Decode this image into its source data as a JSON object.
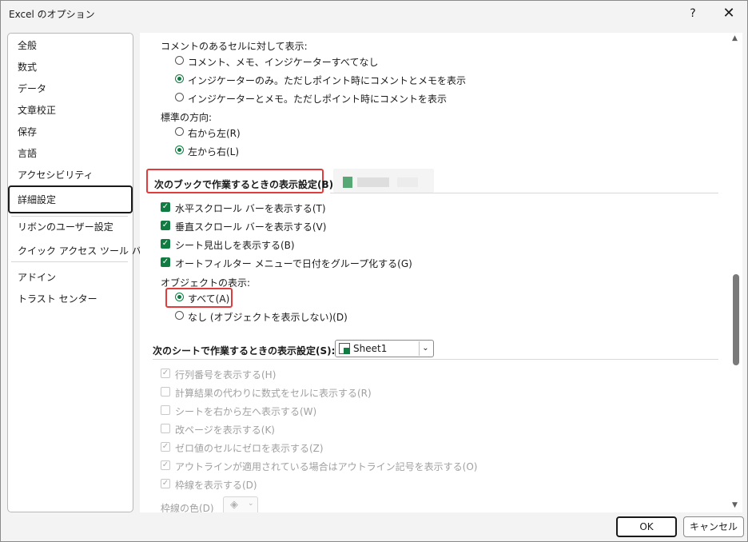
{
  "window": {
    "title": "Excel のオプション",
    "help": "?",
    "close": "✕"
  },
  "sidebar": {
    "items": [
      "全般",
      "数式",
      "データ",
      "文章校正",
      "保存",
      "言語",
      "アクセシビリティ",
      "詳細設定",
      "リボンのユーザー設定",
      "クイック アクセス ツール バー",
      "アドイン",
      "トラスト センター"
    ],
    "selected": "詳細設定"
  },
  "content": {
    "comment_display": {
      "label": "コメントのあるセルに対して表示:",
      "options": [
        "コメント、メモ、インジケーターすべてなし",
        "インジケーターのみ。ただしポイント時にコメントとメモを表示",
        "インジケーターとメモ。ただしポイント時にコメントを表示"
      ],
      "selected_index": 1
    },
    "direction": {
      "label": "標準の方向:",
      "options": [
        "右から左(R)",
        "左から右(L)"
      ],
      "selected_index": 1
    },
    "workbook_section": {
      "title": "次のブックで作業するときの表示設定(B):",
      "checkboxes": [
        "水平スクロール バーを表示する(T)",
        "垂直スクロール バーを表示する(V)",
        "シート見出しを表示する(B)",
        "オートフィルター メニューで日付をグループ化する(G)"
      ],
      "objects_label": "オブジェクトの表示:",
      "object_options": [
        "すべて(A)",
        "なし (オブジェクトを表示しない)(D)"
      ],
      "object_selected_index": 0
    },
    "sheet_section": {
      "title": "次のシートで作業するときの表示設定(S):",
      "sheet_name": "Sheet1",
      "disabled_options": [
        {
          "label": "行列番号を表示する(H)",
          "checked": true
        },
        {
          "label": "計算結果の代わりに数式をセルに表示する(R)",
          "checked": false
        },
        {
          "label": "シートを右から左へ表示する(W)",
          "checked": false
        },
        {
          "label": "改ページを表示する(K)",
          "checked": false
        },
        {
          "label": "ゼロ値のセルにゼロを表示する(Z)",
          "checked": true
        },
        {
          "label": "アウトラインが適用されている場合はアウトライン記号を表示する(O)",
          "checked": true
        },
        {
          "label": "枠線を表示する(D)",
          "checked": true
        }
      ],
      "gridline_color_label": "枠線の色(D)"
    }
  },
  "buttons": {
    "ok": "OK",
    "cancel": "キャンセル"
  },
  "colors": {
    "accent": "#107c41",
    "highlight": "#e03c3c"
  },
  "icons": {
    "help": "help-icon",
    "close": "close-icon",
    "checkbox": "checkmark-icon",
    "fill": "paint-bucket-icon",
    "sheet": "excel-sheet-icon"
  }
}
